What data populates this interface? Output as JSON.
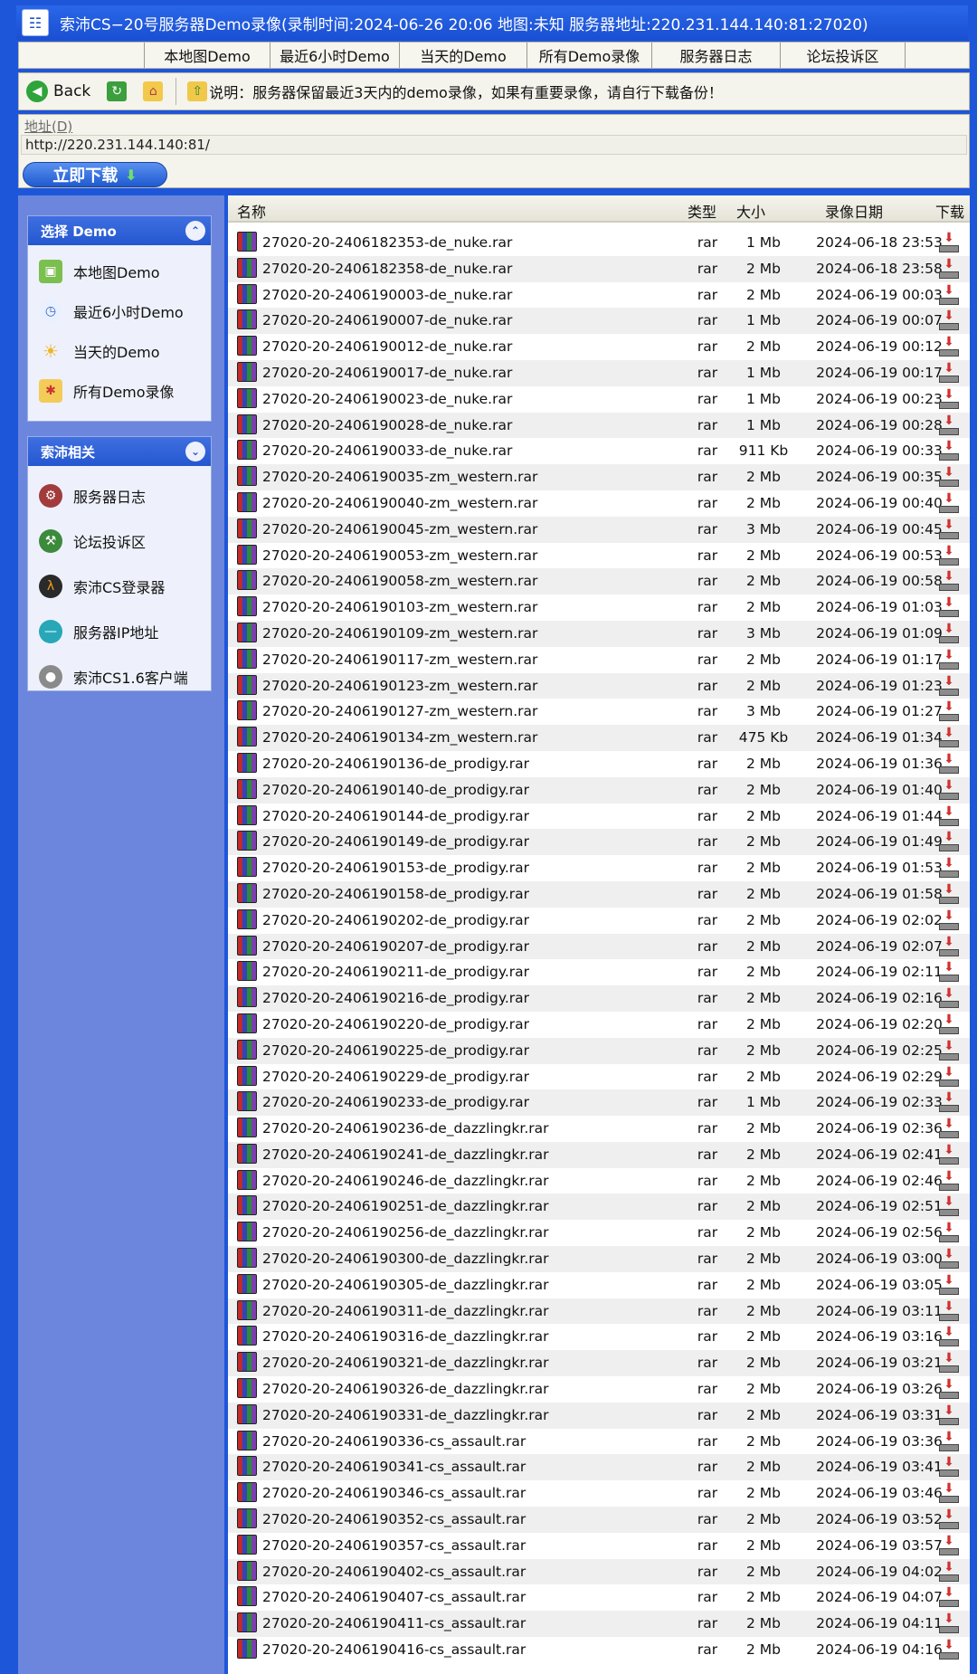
{
  "title": "索沛CS−20号服务器Demo录像(录制时间:2024-06-26 20:06 地图:未知 服务器地址:220.231.144.140:81:27020)",
  "menu": [
    "本地图Demo",
    "最近6小时Demo",
    "当天的Demo",
    "所有Demo录像",
    "服务器日志",
    "论坛投诉区"
  ],
  "toolbar": {
    "back_label": "Back",
    "note": "说明：服务器保留最近3天内的demo录像，如果有重要录像，请自行下载备份！"
  },
  "address": {
    "label": "地址(D)",
    "value": "http://220.231.144.140:81/",
    "download_now": "立即下载"
  },
  "sidebar": {
    "box1": {
      "title": "选择 Demo",
      "items": [
        "本地图Demo",
        "最近6小时Demo",
        "当天的Demo",
        "所有Demo录像"
      ]
    },
    "box2": {
      "title": "索沛相关",
      "items": [
        "服务器日志",
        "论坛投诉区",
        "索沛CS登录器",
        "服务器IP地址",
        "索沛CS1.6客户端"
      ]
    }
  },
  "table": {
    "headers": [
      "名称",
      "类型",
      "大小",
      "录像日期",
      "下载"
    ],
    "rows": [
      [
        "27020-20-2406182353-de_nuke.rar",
        "rar",
        "1 Mb",
        "2024-06-18 23:53"
      ],
      [
        "27020-20-2406182358-de_nuke.rar",
        "rar",
        "2 Mb",
        "2024-06-18 23:58"
      ],
      [
        "27020-20-2406190003-de_nuke.rar",
        "rar",
        "2 Mb",
        "2024-06-19 00:03"
      ],
      [
        "27020-20-2406190007-de_nuke.rar",
        "rar",
        "1 Mb",
        "2024-06-19 00:07"
      ],
      [
        "27020-20-2406190012-de_nuke.rar",
        "rar",
        "2 Mb",
        "2024-06-19 00:12"
      ],
      [
        "27020-20-2406190017-de_nuke.rar",
        "rar",
        "1 Mb",
        "2024-06-19 00:17"
      ],
      [
        "27020-20-2406190023-de_nuke.rar",
        "rar",
        "1 Mb",
        "2024-06-19 00:23"
      ],
      [
        "27020-20-2406190028-de_nuke.rar",
        "rar",
        "1 Mb",
        "2024-06-19 00:28"
      ],
      [
        "27020-20-2406190033-de_nuke.rar",
        "rar",
        "911 Kb",
        "2024-06-19 00:33"
      ],
      [
        "27020-20-2406190035-zm_western.rar",
        "rar",
        "2 Mb",
        "2024-06-19 00:35"
      ],
      [
        "27020-20-2406190040-zm_western.rar",
        "rar",
        "2 Mb",
        "2024-06-19 00:40"
      ],
      [
        "27020-20-2406190045-zm_western.rar",
        "rar",
        "3 Mb",
        "2024-06-19 00:45"
      ],
      [
        "27020-20-2406190053-zm_western.rar",
        "rar",
        "2 Mb",
        "2024-06-19 00:53"
      ],
      [
        "27020-20-2406190058-zm_western.rar",
        "rar",
        "2 Mb",
        "2024-06-19 00:58"
      ],
      [
        "27020-20-2406190103-zm_western.rar",
        "rar",
        "2 Mb",
        "2024-06-19 01:03"
      ],
      [
        "27020-20-2406190109-zm_western.rar",
        "rar",
        "3 Mb",
        "2024-06-19 01:09"
      ],
      [
        "27020-20-2406190117-zm_western.rar",
        "rar",
        "2 Mb",
        "2024-06-19 01:17"
      ],
      [
        "27020-20-2406190123-zm_western.rar",
        "rar",
        "2 Mb",
        "2024-06-19 01:23"
      ],
      [
        "27020-20-2406190127-zm_western.rar",
        "rar",
        "3 Mb",
        "2024-06-19 01:27"
      ],
      [
        "27020-20-2406190134-zm_western.rar",
        "rar",
        "475 Kb",
        "2024-06-19 01:34"
      ],
      [
        "27020-20-2406190136-de_prodigy.rar",
        "rar",
        "2 Mb",
        "2024-06-19 01:36"
      ],
      [
        "27020-20-2406190140-de_prodigy.rar",
        "rar",
        "2 Mb",
        "2024-06-19 01:40"
      ],
      [
        "27020-20-2406190144-de_prodigy.rar",
        "rar",
        "2 Mb",
        "2024-06-19 01:44"
      ],
      [
        "27020-20-2406190149-de_prodigy.rar",
        "rar",
        "2 Mb",
        "2024-06-19 01:49"
      ],
      [
        "27020-20-2406190153-de_prodigy.rar",
        "rar",
        "2 Mb",
        "2024-06-19 01:53"
      ],
      [
        "27020-20-2406190158-de_prodigy.rar",
        "rar",
        "2 Mb",
        "2024-06-19 01:58"
      ],
      [
        "27020-20-2406190202-de_prodigy.rar",
        "rar",
        "2 Mb",
        "2024-06-19 02:02"
      ],
      [
        "27020-20-2406190207-de_prodigy.rar",
        "rar",
        "2 Mb",
        "2024-06-19 02:07"
      ],
      [
        "27020-20-2406190211-de_prodigy.rar",
        "rar",
        "2 Mb",
        "2024-06-19 02:11"
      ],
      [
        "27020-20-2406190216-de_prodigy.rar",
        "rar",
        "2 Mb",
        "2024-06-19 02:16"
      ],
      [
        "27020-20-2406190220-de_prodigy.rar",
        "rar",
        "2 Mb",
        "2024-06-19 02:20"
      ],
      [
        "27020-20-2406190225-de_prodigy.rar",
        "rar",
        "2 Mb",
        "2024-06-19 02:25"
      ],
      [
        "27020-20-2406190229-de_prodigy.rar",
        "rar",
        "2 Mb",
        "2024-06-19 02:29"
      ],
      [
        "27020-20-2406190233-de_prodigy.rar",
        "rar",
        "1 Mb",
        "2024-06-19 02:33"
      ],
      [
        "27020-20-2406190236-de_dazzlingkr.rar",
        "rar",
        "2 Mb",
        "2024-06-19 02:36"
      ],
      [
        "27020-20-2406190241-de_dazzlingkr.rar",
        "rar",
        "2 Mb",
        "2024-06-19 02:41"
      ],
      [
        "27020-20-2406190246-de_dazzlingkr.rar",
        "rar",
        "2 Mb",
        "2024-06-19 02:46"
      ],
      [
        "27020-20-2406190251-de_dazzlingkr.rar",
        "rar",
        "2 Mb",
        "2024-06-19 02:51"
      ],
      [
        "27020-20-2406190256-de_dazzlingkr.rar",
        "rar",
        "2 Mb",
        "2024-06-19 02:56"
      ],
      [
        "27020-20-2406190300-de_dazzlingkr.rar",
        "rar",
        "2 Mb",
        "2024-06-19 03:00"
      ],
      [
        "27020-20-2406190305-de_dazzlingkr.rar",
        "rar",
        "2 Mb",
        "2024-06-19 03:05"
      ],
      [
        "27020-20-2406190311-de_dazzlingkr.rar",
        "rar",
        "2 Mb",
        "2024-06-19 03:11"
      ],
      [
        "27020-20-2406190316-de_dazzlingkr.rar",
        "rar",
        "2 Mb",
        "2024-06-19 03:16"
      ],
      [
        "27020-20-2406190321-de_dazzlingkr.rar",
        "rar",
        "2 Mb",
        "2024-06-19 03:21"
      ],
      [
        "27020-20-2406190326-de_dazzlingkr.rar",
        "rar",
        "2 Mb",
        "2024-06-19 03:26"
      ],
      [
        "27020-20-2406190331-de_dazzlingkr.rar",
        "rar",
        "2 Mb",
        "2024-06-19 03:31"
      ],
      [
        "27020-20-2406190336-cs_assault.rar",
        "rar",
        "2 Mb",
        "2024-06-19 03:36"
      ],
      [
        "27020-20-2406190341-cs_assault.rar",
        "rar",
        "2 Mb",
        "2024-06-19 03:41"
      ],
      [
        "27020-20-2406190346-cs_assault.rar",
        "rar",
        "2 Mb",
        "2024-06-19 03:46"
      ],
      [
        "27020-20-2406190352-cs_assault.rar",
        "rar",
        "2 Mb",
        "2024-06-19 03:52"
      ],
      [
        "27020-20-2406190357-cs_assault.rar",
        "rar",
        "2 Mb",
        "2024-06-19 03:57"
      ],
      [
        "27020-20-2406190402-cs_assault.rar",
        "rar",
        "2 Mb",
        "2024-06-19 04:02"
      ],
      [
        "27020-20-2406190407-cs_assault.rar",
        "rar",
        "2 Mb",
        "2024-06-19 04:07"
      ],
      [
        "27020-20-2406190411-cs_assault.rar",
        "rar",
        "2 Mb",
        "2024-06-19 04:11"
      ],
      [
        "27020-20-2406190416-cs_assault.rar",
        "rar",
        "2 Mb",
        "2024-06-19 04:16"
      ]
    ]
  }
}
